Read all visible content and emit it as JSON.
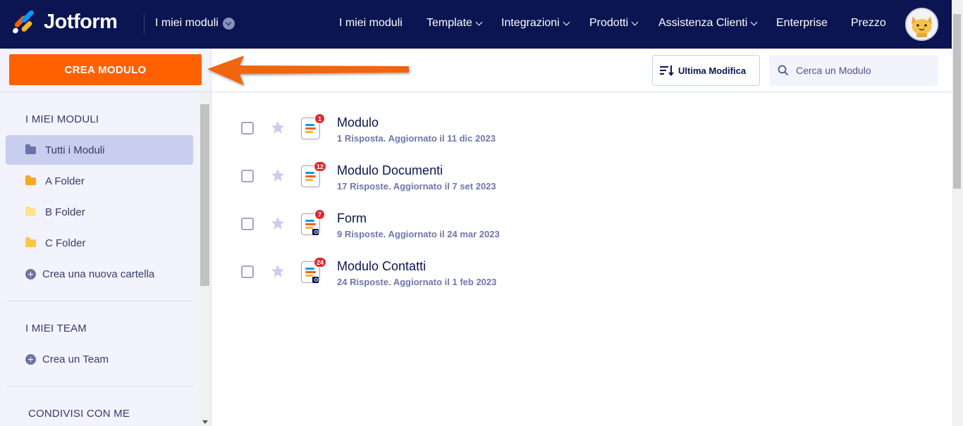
{
  "brand": {
    "name": "Jotform"
  },
  "topnav": {
    "context": "I miei moduli",
    "menu": [
      {
        "label": "I miei moduli",
        "dropdown": false
      },
      {
        "label": "Template",
        "dropdown": true
      },
      {
        "label": "Integrazioni",
        "dropdown": true
      },
      {
        "label": "Prodotti",
        "dropdown": true
      },
      {
        "label": "Assistenza Clienti",
        "dropdown": true
      },
      {
        "label": "Enterprise",
        "dropdown": false
      },
      {
        "label": "Prezzo",
        "dropdown": false
      }
    ]
  },
  "sidebar": {
    "create_label": "CREA MODULO",
    "my_forms_title": "I MIEI MODULI",
    "folders": [
      {
        "label": "Tutti i Moduli",
        "color": "#6c73a8",
        "active": true
      },
      {
        "label": "A Folder",
        "color": "#f9a825",
        "active": false
      },
      {
        "label": "B Folder",
        "color": "#ffe38c",
        "active": false
      },
      {
        "label": "C Folder",
        "color": "#ffc640",
        "active": false
      }
    ],
    "new_folder_label": "Crea una nuova cartella",
    "teams_title": "I MIEI TEAM",
    "new_team_label": "Crea un Team",
    "shared_title": "CONDIVISI CON ME"
  },
  "toolbar": {
    "sort_label": "Ultima Modifica",
    "search_placeholder": "Cerca un Modulo"
  },
  "forms": [
    {
      "title": "Modulo",
      "meta": "1 Risposta. Aggiornato il 11 dic 2023",
      "badge": "1",
      "lock": false
    },
    {
      "title": "Modulo Documenti",
      "meta": "17 Risposte. Aggiornato il 7 set 2023",
      "badge": "12",
      "lock": false
    },
    {
      "title": "Form",
      "meta": "9 Risposte. Aggiornato il 24 mar 2023",
      "badge": "7",
      "lock": true
    },
    {
      "title": "Modulo Contatti",
      "meta": "24 Risposte. Aggiornato il 1 feb 2023",
      "badge": "24",
      "lock": true
    }
  ],
  "colors": {
    "navy": "#0a1551",
    "orange": "#ff6100",
    "sidebar_bg": "#f3f3fe",
    "badge_red": "#e1262d"
  }
}
